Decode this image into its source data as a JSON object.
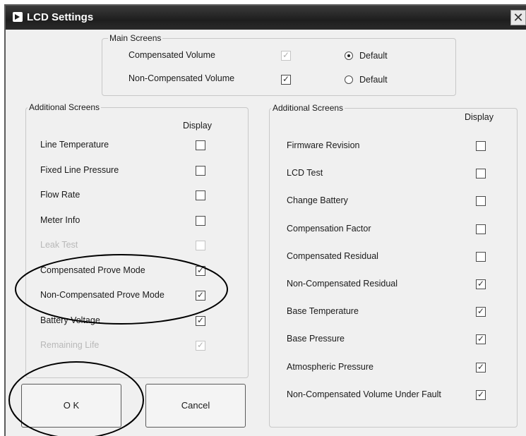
{
  "window": {
    "title": "LCD Settings",
    "close_glyph": "✕",
    "icon": "app-icon"
  },
  "main_screens": {
    "legend": "Main Screens",
    "rows": [
      {
        "label": "Compensated Volume",
        "checked": true,
        "disabled": true,
        "radio_label": "Default",
        "radio_selected": true
      },
      {
        "label": "Non-Compensated Volume",
        "checked": true,
        "disabled": false,
        "radio_label": "Default",
        "radio_selected": false
      }
    ]
  },
  "left_group": {
    "legend": "Additional Screens",
    "display_header": "Display",
    "items": [
      {
        "label": "Line Temperature",
        "checked": false,
        "disabled": false
      },
      {
        "label": "Fixed Line Pressure",
        "checked": false,
        "disabled": false
      },
      {
        "label": "Flow Rate",
        "checked": false,
        "disabled": false
      },
      {
        "label": "Meter Info",
        "checked": false,
        "disabled": false
      },
      {
        "label": "Leak Test",
        "checked": false,
        "disabled": true
      },
      {
        "label": "Compensated Prove Mode",
        "checked": true,
        "disabled": false
      },
      {
        "label": "Non-Compensated Prove Mode",
        "checked": true,
        "disabled": false
      },
      {
        "label": "Battery Voltage",
        "checked": true,
        "disabled": false
      },
      {
        "label": "Remaining Life",
        "checked": true,
        "disabled": true
      }
    ]
  },
  "right_group": {
    "legend": "Additional Screens",
    "display_header": "Display",
    "items": [
      {
        "label": "Firmware Revision",
        "checked": false
      },
      {
        "label": "LCD Test",
        "checked": false
      },
      {
        "label": "Change Battery",
        "checked": false
      },
      {
        "label": "Compensation Factor",
        "checked": false
      },
      {
        "label": "Compensated Residual",
        "checked": false
      },
      {
        "label": "Non-Compensated Residual",
        "checked": true
      },
      {
        "label": "Base Temperature",
        "checked": true
      },
      {
        "label": "Base Pressure",
        "checked": true
      },
      {
        "label": "Atmospheric Pressure",
        "checked": true
      },
      {
        "label": "Non-Compensated Volume Under Fault",
        "checked": true
      }
    ]
  },
  "buttons": {
    "ok": "O K",
    "cancel": "Cancel"
  },
  "colors": {
    "titlebar": "#1e1e1e",
    "dialog_bg": "#f0f0f0",
    "annotation": "#000000"
  }
}
